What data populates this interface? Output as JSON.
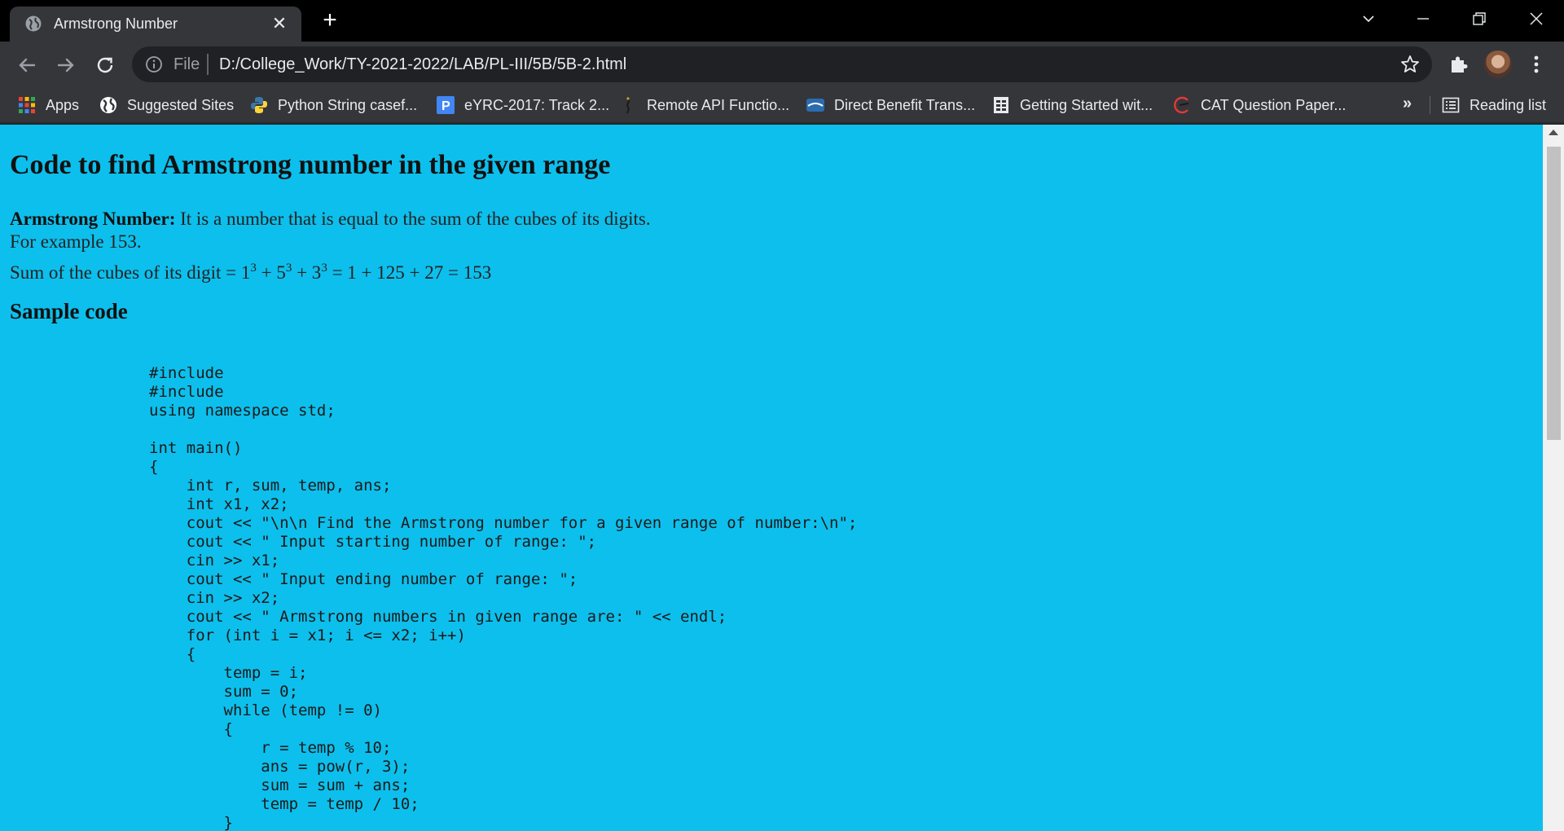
{
  "tab": {
    "title": "Armstrong Number",
    "close": "✕"
  },
  "new_tab": "+",
  "address": {
    "file_label": "File",
    "url": "D:/College_Work/TY-2021-2022/LAB/PL-III/5B/5B-2.html"
  },
  "bookmarks": {
    "items": [
      {
        "label": "Apps"
      },
      {
        "label": "Suggested Sites"
      },
      {
        "label": "Python String casef..."
      },
      {
        "label": "eYRC-2017: Track 2..."
      },
      {
        "label": "Remote API Functio..."
      },
      {
        "label": "Direct Benefit Trans..."
      },
      {
        "label": "Getting Started wit..."
      },
      {
        "label": "CAT Question Paper..."
      }
    ],
    "more": "»",
    "reading_list": "Reading list"
  },
  "page": {
    "heading": "Code to find Armstrong number in the given range",
    "term": "Armstrong Number:",
    "definition": " It is a number that is equal to the sum of the cubes of its digits.",
    "example": "For example 153.",
    "sum_prefix": "Sum of the cubes of its digit = 1",
    "exp": "3",
    "plus5": " + 5",
    "plus3": " + 3",
    "sum_suffix": " = 1 + 125 + 27 = 153",
    "section_title": "Sample code",
    "code": "#include\n#include\nusing namespace std;\n\nint main()\n{\n    int r, sum, temp, ans;\n    int x1, x2;\n    cout << \"\\n\\n Find the Armstrong number for a given range of number:\\n\";\n    cout << \" Input starting number of range: \";\n    cin >> x1;\n    cout << \" Input ending number of range: \";\n    cin >> x2;\n    cout << \" Armstrong numbers in given range are: \" << endl;\n    for (int i = x1; i <= x2; i++)\n    {\n        temp = i;\n        sum = 0;\n        while (temp != 0)\n        {\n            r = temp % 10;\n            ans = pow(r, 3);\n            sum = sum + ans;\n            temp = temp / 10;\n        }"
  }
}
